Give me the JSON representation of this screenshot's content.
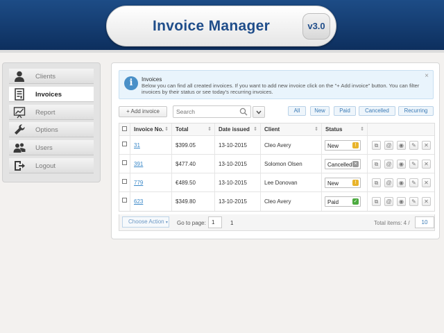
{
  "header": {
    "title": "Invoice Manager",
    "version": "v3.0"
  },
  "sidebar": {
    "items": [
      {
        "label": "Clients",
        "icon": "user-icon"
      },
      {
        "label": "Invoices",
        "icon": "document-icon",
        "active": true
      },
      {
        "label": "Report",
        "icon": "chart-icon"
      },
      {
        "label": "Options",
        "icon": "wrench-icon"
      },
      {
        "label": "Users",
        "icon": "users-icon"
      },
      {
        "label": "Logout",
        "icon": "logout-icon"
      }
    ]
  },
  "info": {
    "title": "Invoices",
    "text": "Below you can find all created invoices. If you want to add new invoice click on the \"+ Add invoice\" button. You can filter invoices by their status or see today's recurring invoices.",
    "close": "×"
  },
  "toolbar": {
    "add_label": "+ Add invoice",
    "search_placeholder": "Search",
    "dropdown": "⌄",
    "filters": [
      "All",
      "New",
      "Paid",
      "Cancelled",
      "Recurring"
    ]
  },
  "table": {
    "headers": [
      "Invoice No.",
      "Total",
      "Date issued",
      "Client",
      "Status"
    ],
    "rows": [
      {
        "no": "31",
        "total": "$399.05",
        "date": "13-10-2015",
        "client": "Cleo Avery",
        "status": "New",
        "status_color": "#e8b32b",
        "status_icon": "!"
      },
      {
        "no": "391",
        "total": "$477.40",
        "date": "13-10-2015",
        "client": "Solomon Olsen",
        "status": "Cancelled",
        "status_color": "#9a9a9a",
        "status_icon": "×"
      },
      {
        "no": "779",
        "total": "€489.50",
        "date": "13-10-2015",
        "client": "Lee Donovan",
        "status": "New",
        "status_color": "#e8b32b",
        "status_icon": "!"
      },
      {
        "no": "623",
        "total": "$349.80",
        "date": "13-10-2015",
        "client": "Cleo Avery",
        "status": "Paid",
        "status_color": "#4caa3f",
        "status_icon": "✓"
      }
    ],
    "actions": [
      "copy-icon",
      "email-icon",
      "view-icon",
      "edit-icon",
      "delete-icon"
    ]
  },
  "footer": {
    "choose_action": "Choose Action",
    "goto_label": "Go to page:",
    "page_input": "1",
    "page_num": "1",
    "total_label": "Total items: 4 /",
    "per_page": "10"
  }
}
